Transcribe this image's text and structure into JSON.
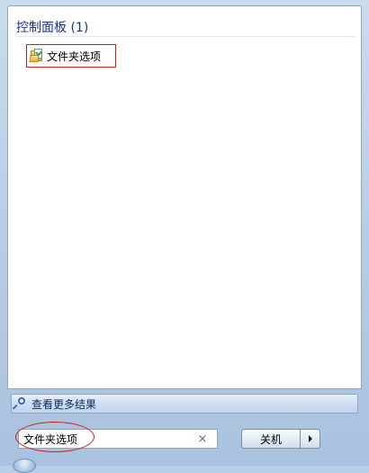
{
  "results": {
    "group_title": "控制面板 (1)",
    "items": [
      {
        "label": "文件夹选项",
        "icon": "folder-options-icon"
      }
    ]
  },
  "see_more": {
    "label": "查看更多结果",
    "icon": "search-icon"
  },
  "search": {
    "value": "文件夹选项",
    "clear_icon": "×"
  },
  "shutdown": {
    "label": "关机"
  },
  "colors": {
    "group_title": "#1e3287",
    "highlight": "#cc1f1f",
    "menu_background": "#b9cfe7"
  }
}
